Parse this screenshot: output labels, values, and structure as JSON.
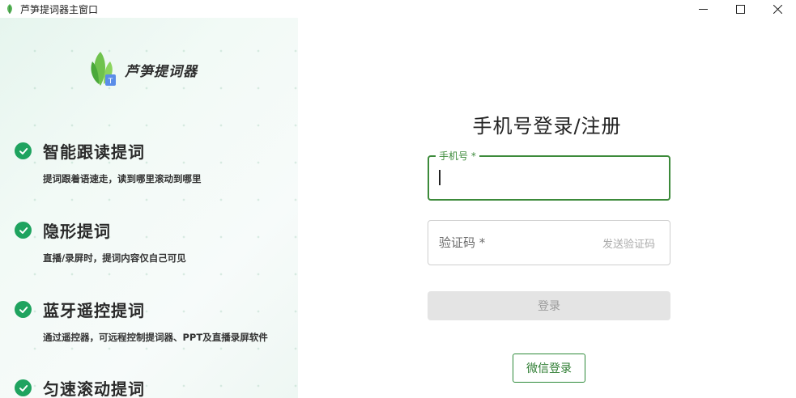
{
  "window": {
    "title": "芦笋提词器主窗口",
    "controls": {
      "minimize": "—",
      "maximize": "☐",
      "close": "✕"
    }
  },
  "brand": {
    "name": "芦笋提词器",
    "logo_badge": "T"
  },
  "features": [
    {
      "title": "智能跟读提词",
      "desc": "提词跟着语速走，读到哪里滚动到哪里"
    },
    {
      "title": "隐形提词",
      "desc": "直播/录屏时，提词内容仅自己可见"
    },
    {
      "title": "蓝牙遥控提词",
      "desc": "通过遥控器，可远程控制提词器、PPT及直播录屏软件"
    },
    {
      "title": "匀速滚动提词",
      "desc": ""
    }
  ],
  "login": {
    "heading": "手机号登录/注册",
    "phone_label": "手机号 *",
    "phone_value": "",
    "code_placeholder": "验证码 *",
    "send_code": "发送验证码",
    "login_button": "登录",
    "wechat_button": "微信登录"
  },
  "colors": {
    "accent_green": "#1fa35f",
    "focus_border": "#3c8a3a",
    "disabled_button": "#e4e4e4"
  }
}
